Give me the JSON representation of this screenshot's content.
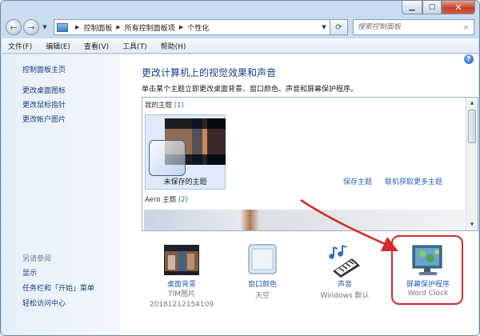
{
  "window": {
    "caption_buttons": [
      "minimize",
      "maximize",
      "close"
    ]
  },
  "nav": {
    "back_icon": "back-arrow-icon",
    "forward_icon": "forward-arrow-icon",
    "breadcrumbs": [
      "控制面板",
      "所有控制面板项",
      "个性化"
    ],
    "search_placeholder": "搜索控制面板"
  },
  "menubar": {
    "items": [
      "文件(F)",
      "编辑(E)",
      "查看(V)",
      "工具(T)",
      "帮助(H)"
    ]
  },
  "sidebar": {
    "home": "控制面板主页",
    "links": [
      "更改桌面图标",
      "更改鼠标指针",
      "更改帐户图片"
    ],
    "see_also_heading": "另请参阅",
    "see_also": [
      "显示",
      "任务栏和「开始」菜单",
      "轻松访问中心"
    ]
  },
  "main": {
    "title": "更改计算机上的视觉效果和声音",
    "description": "单击某个主题立即更改桌面背景、窗口颜色、声音和屏幕保护程序。",
    "my_themes_label": "我的主题",
    "my_themes_count": "(1)",
    "unsaved_theme": "未保存的主题",
    "save_theme": "保存主题",
    "get_more_themes": "联机获取更多主题",
    "aero_label": "Aero 主题",
    "aero_count": "(2)"
  },
  "bottom": [
    {
      "label": "桌面背景",
      "sub": "TIM图片\n20181212154109",
      "icon": "desktop-background-icon"
    },
    {
      "label": "窗口颜色",
      "sub": "天空",
      "icon": "window-color-icon"
    },
    {
      "label": "声音",
      "sub": "Windows 默认",
      "icon": "sound-icon"
    },
    {
      "label": "屏幕保护程序",
      "sub": "Word Clock",
      "icon": "screensaver-icon"
    }
  ],
  "colors": {
    "link": "#2a5db0",
    "title": "#1c3f8a",
    "annotation_red": "#d52a2a"
  }
}
